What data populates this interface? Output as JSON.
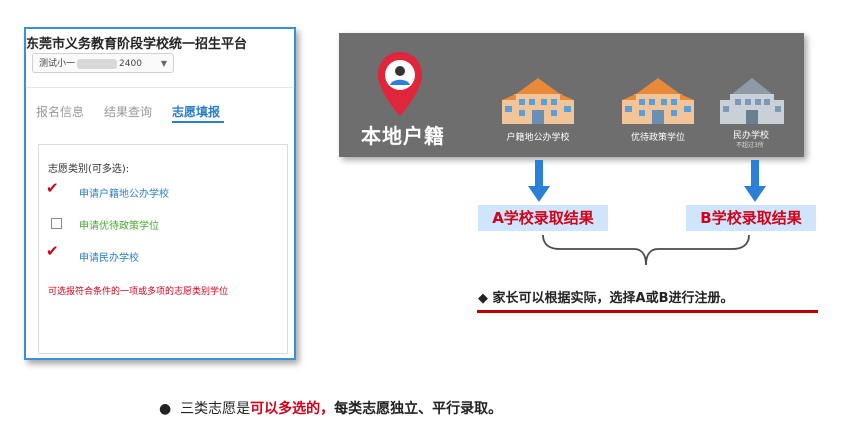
{
  "app": {
    "title": "东莞市义务教育阶段学校统一招生平台",
    "user_select": {
      "prefix": "测试小一",
      "suffix": "2400"
    }
  },
  "tabs": [
    {
      "label": "报名信息"
    },
    {
      "label": "结果查询"
    },
    {
      "label": "志愿填报"
    }
  ],
  "form": {
    "category_label": "志愿类别(可多选):",
    "options": [
      {
        "label": "申请户籍地公办学校",
        "checked": true,
        "color": "#2a7fc7"
      },
      {
        "label": "申请优待政策学位",
        "checked": false,
        "color": "#4aa832"
      },
      {
        "label": "申请民办学校",
        "checked": true,
        "color": "#2a7fc7"
      }
    ],
    "hint": "可选报符合条件的一项或多项的志愿类别学位"
  },
  "banner": {
    "label": "本地户籍",
    "schools": [
      {
        "label": "户籍地公办学校"
      },
      {
        "label": "优待政策学位"
      },
      {
        "label": "民办学校",
        "sub": "不超过3所"
      }
    ]
  },
  "results": {
    "a": "A学校录取结果",
    "b": "B学校录取结果"
  },
  "note": {
    "bullet": "◆",
    "text": "家长可以根据实际，选择A或B进行注册。"
  },
  "footer": {
    "bullet": "●",
    "plain": "三类志愿是",
    "red": "可以多选的，",
    "bold": "每类志愿独立、平行录取。"
  },
  "colors": {
    "accent_blue": "#2a7fc7",
    "red": "#d0021b",
    "banner_bg": "#6e6e6e",
    "result_bg": "#cfe5fb"
  }
}
